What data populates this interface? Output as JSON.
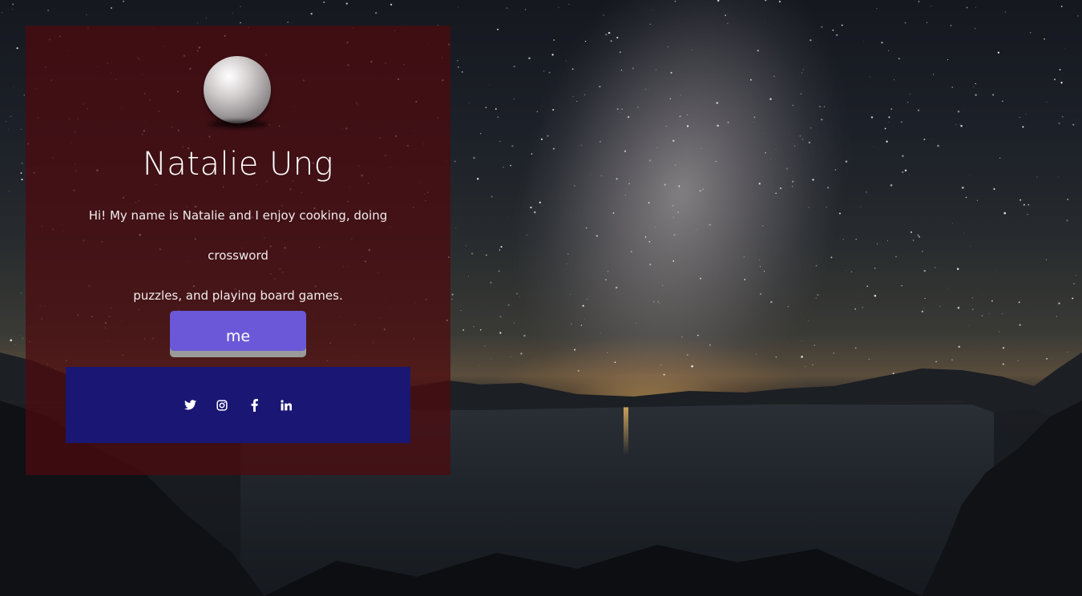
{
  "profile": {
    "name": "Natalie Ung",
    "bio_line_1": "Hi! My name is Natalie and I enjoy cooking, doing crossword",
    "bio_line_2": "puzzles, and playing board games.",
    "avatar_icon": "pearl-ball-icon",
    "button_label": "me"
  },
  "social": [
    {
      "name": "twitter",
      "icon": "twitter-icon"
    },
    {
      "name": "instagram",
      "icon": "instagram-icon"
    },
    {
      "name": "facebook",
      "icon": "facebook-icon"
    },
    {
      "name": "linkedin",
      "icon": "linkedin-icon"
    }
  ],
  "colors": {
    "card_background": "#4e0a0e",
    "button_background": "#6b58d8",
    "button_shadow": "#9a9a9a",
    "social_bar_background": "#1a1674",
    "text": "#ffffff"
  },
  "background": {
    "scene": "starry night sky with milky way over a lake",
    "icon": "night-sky-background"
  }
}
